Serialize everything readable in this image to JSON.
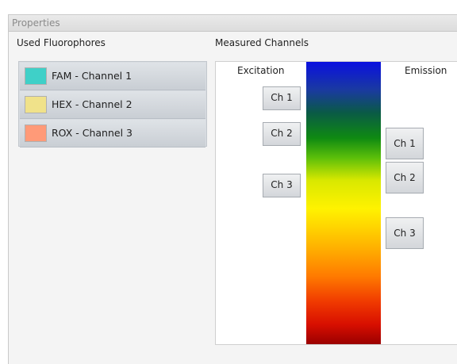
{
  "window": {
    "title": "Properties"
  },
  "fluorophores": {
    "heading": "Used Fluorophores",
    "items": [
      {
        "label": "FAM - Channel 1",
        "color": "#3fd0c8"
      },
      {
        "label": "HEX - Channel 2",
        "color": "#f0e28a"
      },
      {
        "label": "ROX - Channel 3",
        "color": "#ff9a78"
      }
    ]
  },
  "channels": {
    "heading": "Measured Channels",
    "excitation_label": "Excitation",
    "emission_label": "Emission",
    "excitation": [
      {
        "label": "Ch 1"
      },
      {
        "label": "Ch 2"
      },
      {
        "label": "Ch 3"
      }
    ],
    "emission": [
      {
        "label": "Ch 1"
      },
      {
        "label": "Ch 2"
      },
      {
        "label": "Ch 3"
      }
    ]
  }
}
